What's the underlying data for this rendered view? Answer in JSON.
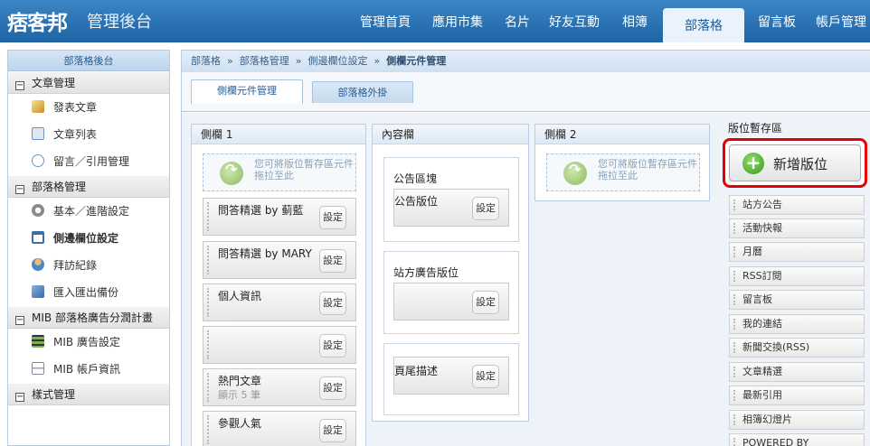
{
  "header": {
    "logo": "痞客邦",
    "subtitle": "管理後台",
    "nav": [
      {
        "label": "管理首頁"
      },
      {
        "label": "應用市集"
      },
      {
        "label": "名片"
      },
      {
        "label": "好友互動"
      },
      {
        "label": "相簿"
      },
      {
        "label": "部落格",
        "active": true
      },
      {
        "label": "留言板"
      },
      {
        "label": "帳戶管理"
      }
    ]
  },
  "sidebar": {
    "title": "部落格後台",
    "sections": [
      {
        "label": "文章管理",
        "items": [
          {
            "label": "發表文章",
            "icon": "pencil-icon"
          },
          {
            "label": "文章列表",
            "icon": "pages-icon"
          },
          {
            "label": "留言／引用管理",
            "icon": "comment-icon"
          }
        ]
      },
      {
        "label": "部落格管理",
        "items": [
          {
            "label": "基本／進階設定",
            "icon": "gear-icon"
          },
          {
            "label": "側邊欄位設定",
            "icon": "layout-icon",
            "active": true
          },
          {
            "label": "拜訪紀錄",
            "icon": "visitors-icon"
          },
          {
            "label": "匯入匯出備份",
            "icon": "backup-icon"
          }
        ]
      },
      {
        "label": "MIB 部落格廣告分潤計畫",
        "items": [
          {
            "label": "MIB 廣告設定",
            "icon": "film-icon"
          },
          {
            "label": "MIB 帳戶資訊",
            "icon": "card-icon"
          }
        ]
      },
      {
        "label": "樣式管理",
        "items": []
      }
    ]
  },
  "breadcrumb": {
    "items": [
      "部落格",
      "部落格管理",
      "側邊欄位設定"
    ],
    "current": "側欄元件管理",
    "separator": "»"
  },
  "tabs": {
    "active": "側欄元件管理",
    "inactive": "部落格外掛"
  },
  "columns": {
    "sidebar1": {
      "title": "側欄 1",
      "drop_hint": "您可將版位暫存區元件拖拉至此",
      "widgets": [
        {
          "title": "問答精選 by 蓟藍",
          "sub": ""
        },
        {
          "title": "問答精選 by MARY",
          "sub": ""
        },
        {
          "title": "個人資訊",
          "sub": ""
        },
        {
          "title": "",
          "sub": ""
        },
        {
          "title": "熱門文章",
          "sub": "顯示 5 筆"
        },
        {
          "title": "參觀人氣",
          "sub": ""
        }
      ]
    },
    "content": {
      "title": "內容欄",
      "blocks": [
        {
          "title": "公告區塊",
          "widget": "公告版位"
        },
        {
          "title": "站方廣告版位",
          "widget": ""
        },
        {
          "title": "",
          "widget": "頁尾描述"
        }
      ]
    },
    "sidebar2": {
      "title": "側欄 2",
      "drop_hint": "您可將版位暫存區元件拖拉至此"
    }
  },
  "set_label": "設定",
  "stash": {
    "title": "版位暫存區",
    "add_label": "新增版位",
    "items": [
      "站方公告",
      "活動快報",
      "月曆",
      "RSS訂閱",
      "留言板",
      "我的連結",
      "新聞交換(RSS)",
      "文章精選",
      "最新引用",
      "相簿幻燈片",
      "POWERED BY"
    ]
  }
}
